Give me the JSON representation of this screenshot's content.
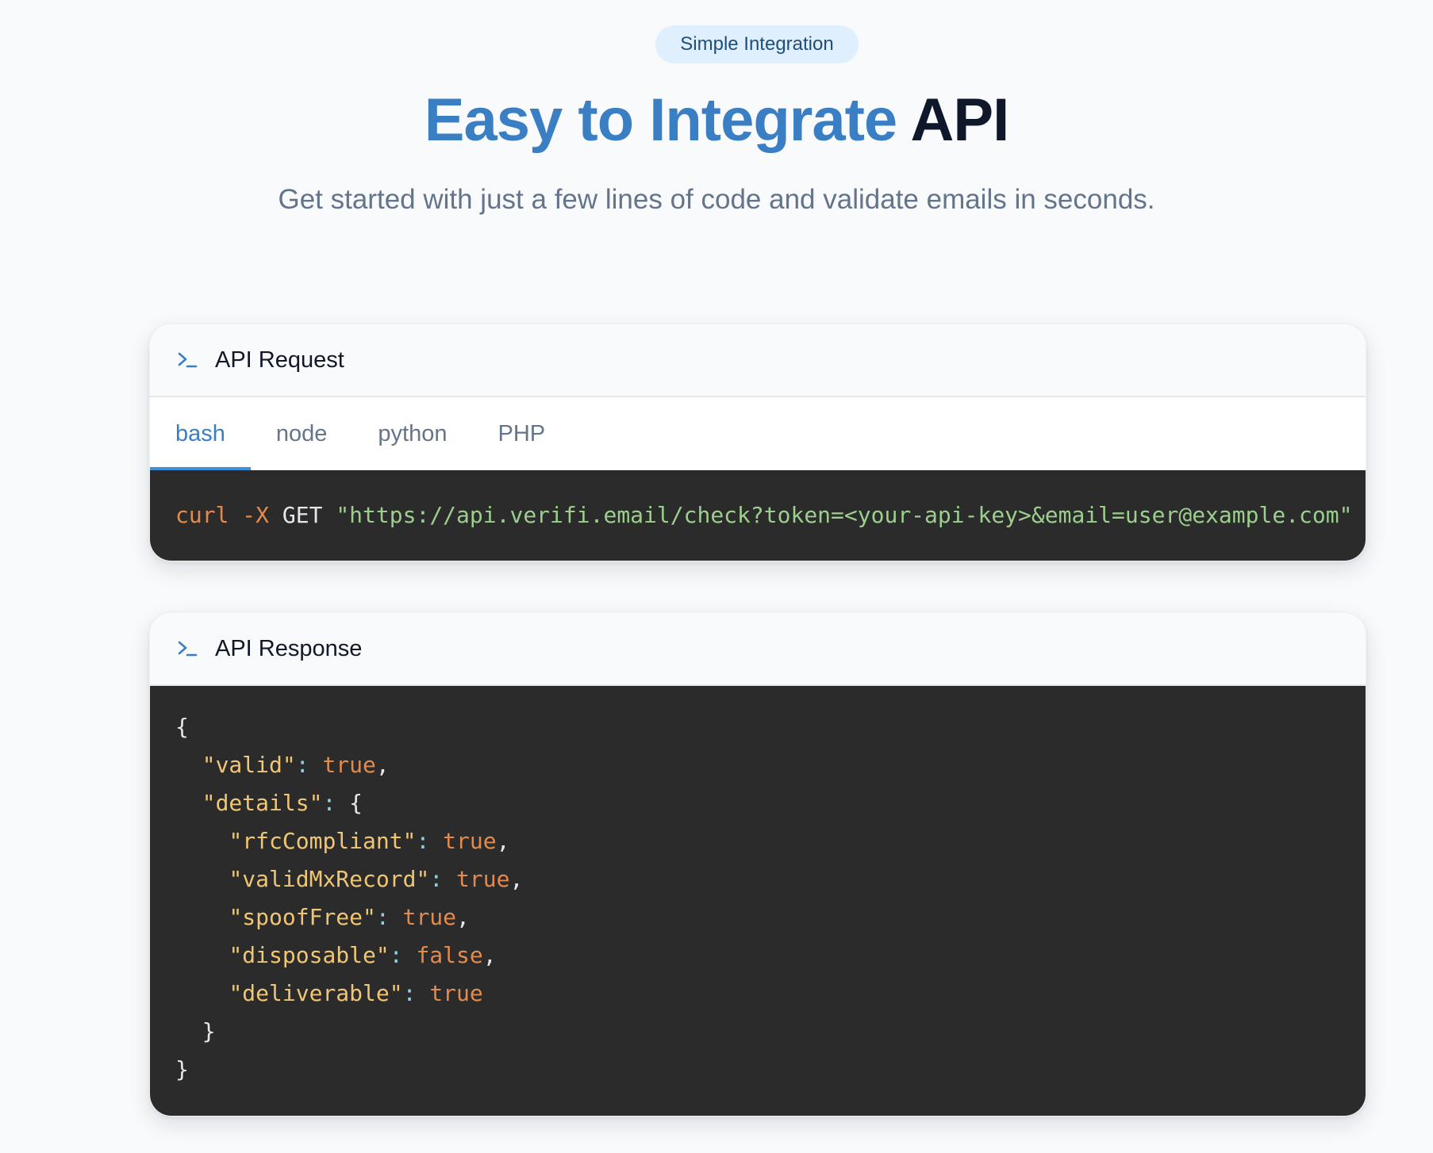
{
  "hero": {
    "badge": "Simple Integration",
    "title_accent": "Easy to Integrate",
    "title_plain": "API",
    "subtitle": "Get started with just a few lines of code and validate emails in seconds."
  },
  "request": {
    "header": "API Request",
    "tabs": [
      "bash",
      "node",
      "python",
      "PHP"
    ],
    "active_tab": "bash",
    "code": {
      "cmd": "curl",
      "flag": "-X",
      "method": "GET",
      "url": "\"https://api.verifi.email/check?token=<your-api-key>&email=user@example.com\""
    }
  },
  "response": {
    "header": "API Response",
    "open_brace": "{",
    "close_brace": "}",
    "valid_key": "\"valid\"",
    "valid_val": "true",
    "details_key": "\"details\"",
    "details_open": "{",
    "details_close": "}",
    "details": [
      {
        "key": "\"rfcCompliant\"",
        "value": "true",
        "comma": ","
      },
      {
        "key": "\"validMxRecord\"",
        "value": "true",
        "comma": ","
      },
      {
        "key": "\"spoofFree\"",
        "value": "true",
        "comma": ","
      },
      {
        "key": "\"disposable\"",
        "value": "false",
        "comma": ","
      },
      {
        "key": "\"deliverable\"",
        "value": "true",
        "comma": ""
      }
    ]
  },
  "colors": {
    "accent": "#3a7fc4",
    "badge_bg": "#e0effd",
    "code_bg": "#2b2b2b",
    "code_keyword": "#e38b4d",
    "code_string": "#9ccf8d",
    "code_key": "#f0c674"
  },
  "icons": {
    "request_header": "terminal-icon",
    "response_header": "terminal-icon"
  }
}
